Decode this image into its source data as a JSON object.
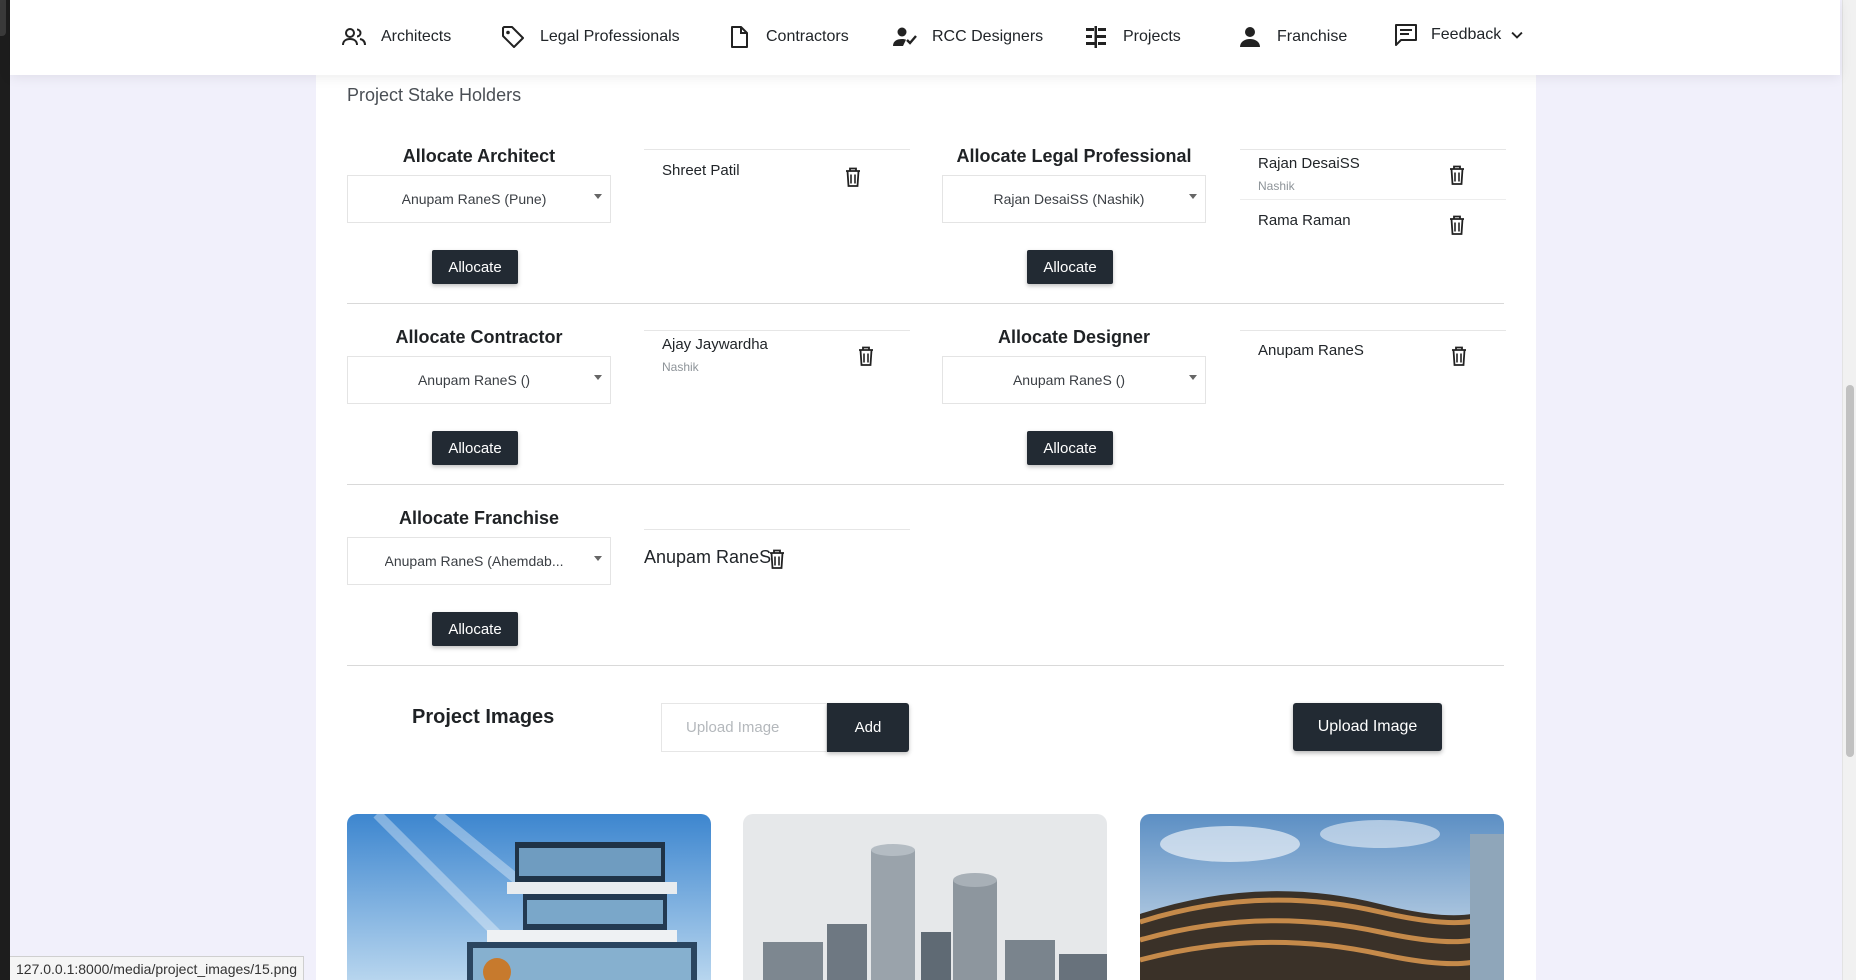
{
  "nav": {
    "architects": "Architects",
    "legal": "Legal Professionals",
    "contractors": "Contractors",
    "rcc": "RCC Designers",
    "projects": "Projects",
    "franchise": "Franchise",
    "feedback": "Feedback"
  },
  "section_title": "Project Stake Holders",
  "architect": {
    "title": "Allocate Architect",
    "selected": "Anupam RaneS (Pune)",
    "button": "Allocate",
    "allocated": [
      {
        "name": "Shreet Patil"
      }
    ]
  },
  "legal": {
    "title": "Allocate Legal Professional",
    "selected": "Rajan DesaiSS (Nashik)",
    "button": "Allocate",
    "allocated": [
      {
        "name": "Rajan DesaiSS",
        "city": "Nashik"
      },
      {
        "name": "Rama Raman"
      }
    ]
  },
  "contractor": {
    "title": "Allocate Contractor",
    "selected": "Anupam RaneS ()",
    "button": "Allocate",
    "allocated": [
      {
        "name": "Ajay Jaywardha",
        "city": "Nashik"
      }
    ]
  },
  "designer": {
    "title": "Allocate Designer",
    "selected": "Anupam RaneS ()",
    "button": "Allocate",
    "allocated": [
      {
        "name": "Anupam RaneS"
      }
    ]
  },
  "franchise": {
    "title": "Allocate Franchise",
    "selected": "Anupam RaneS (Ahemdab...",
    "button": "Allocate",
    "allocated": [
      {
        "name": "Anupam RaneS"
      }
    ]
  },
  "images": {
    "title": "Project Images",
    "input_placeholder": "Upload Image",
    "add": "Add",
    "upload": "Upload Image"
  },
  "status_url": "127.0.0.1:8000/media/project_images/15.png",
  "colors": {
    "dark_button": "#222a33",
    "page_bg": "#f1f0fb"
  }
}
